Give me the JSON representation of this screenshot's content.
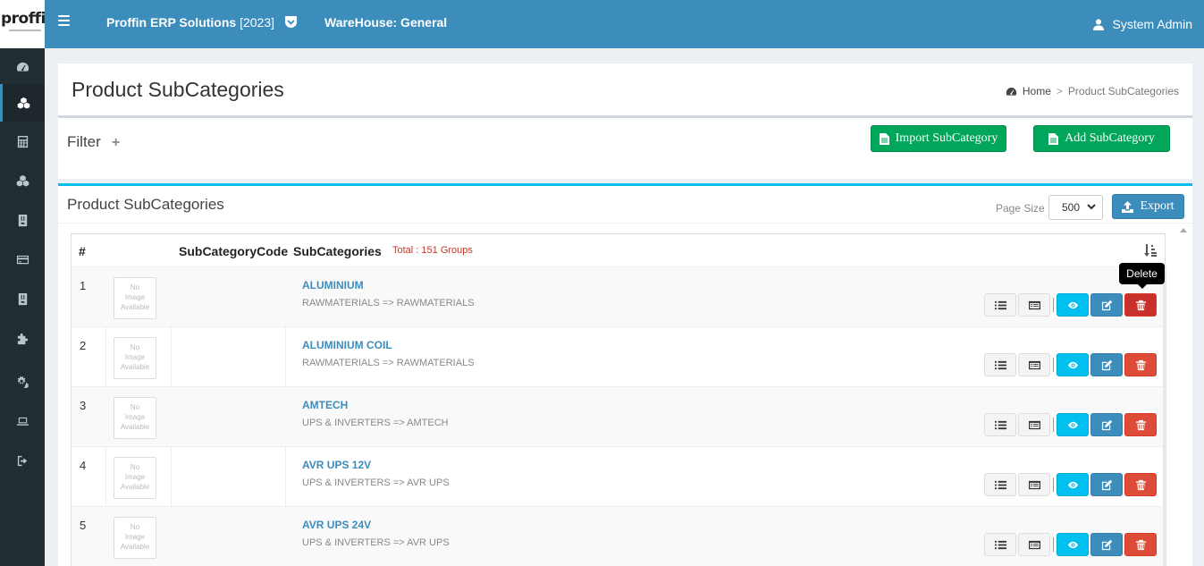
{
  "header": {
    "logo_text": "proffin",
    "app_name": "Proffin ERP Solutions",
    "app_year": "[2023]",
    "warehouse_label": "WareHouse: General",
    "user_name": "System Admin"
  },
  "sidebar": {
    "items": [
      {
        "icon": "dashboard-icon"
      },
      {
        "icon": "cubes-icon",
        "active": true
      },
      {
        "icon": "calculator-icon"
      },
      {
        "icon": "cubes-icon"
      },
      {
        "icon": "inbox-icon"
      },
      {
        "icon": "credit-card-icon"
      },
      {
        "icon": "inbox-icon"
      },
      {
        "icon": "puzzle-icon"
      },
      {
        "icon": "cogs-icon"
      },
      {
        "icon": "laptop-icon"
      },
      {
        "icon": "sign-out-icon"
      }
    ]
  },
  "page": {
    "title": "Product SubCategories",
    "breadcrumb_home": "Home",
    "breadcrumb_sep": ">",
    "breadcrumb_current": "Product SubCategories"
  },
  "filter": {
    "label": "Filter",
    "plus": "+",
    "import_label": "Import SubCategory",
    "add_label": "Add SubCategory"
  },
  "list": {
    "title": "Product SubCategories",
    "page_size_label": "Page Size",
    "page_size_value": "500",
    "export_label": "Export",
    "columns": [
      "#",
      "SubCategoryCode",
      "SubCategories"
    ],
    "total_text": "Total : 151 Groups",
    "no_image_text": [
      "No",
      "Image",
      "Available"
    ],
    "tooltip": "Delete",
    "rows": [
      {
        "num": "1",
        "name": "ALUMINIUM",
        "path": "RAWMATERIALS => RAWMATERIALS"
      },
      {
        "num": "2",
        "name": "ALUMINIUM COIL",
        "path": "RAWMATERIALS => RAWMATERIALS"
      },
      {
        "num": "3",
        "name": "AMTECH",
        "path": "UPS & INVERTERS => AMTECH"
      },
      {
        "num": "4",
        "name": "AVR UPS 12V",
        "path": "UPS & INVERTERS => AVR UPS"
      },
      {
        "num": "5",
        "name": "AVR UPS 24V",
        "path": "UPS & INVERTERS => AVR UPS"
      }
    ]
  },
  "colors": {
    "header_blue": "#3c8dbc",
    "sidebar_dark": "#222d32",
    "green": "#00a65a",
    "info": "#00c0ef",
    "danger": "#dd4b39"
  }
}
